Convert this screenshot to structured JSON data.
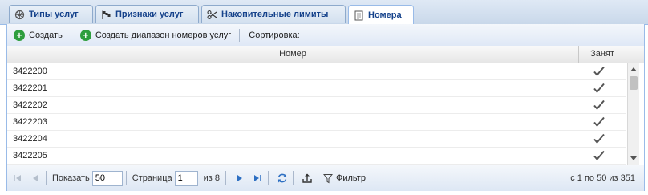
{
  "tabs": [
    {
      "label": "Типы услуг",
      "icon": "wheel-icon",
      "active": false
    },
    {
      "label": "Признаки услуг",
      "icon": "flag-icon",
      "active": false
    },
    {
      "label": "Накопительные лимиты",
      "icon": "scissors-icon",
      "active": false
    },
    {
      "label": "Номера",
      "icon": "document-icon",
      "active": true
    }
  ],
  "toolbar": {
    "create_label": "Создать",
    "create_range_label": "Создать диапазон номеров услуг",
    "sort_label": "Сортировка:"
  },
  "grid": {
    "columns": [
      "Номер",
      "Занят"
    ],
    "rows": [
      {
        "number": "3422200",
        "occupied": true
      },
      {
        "number": "3422201",
        "occupied": true
      },
      {
        "number": "3422202",
        "occupied": true
      },
      {
        "number": "3422203",
        "occupied": true
      },
      {
        "number": "3422204",
        "occupied": true
      },
      {
        "number": "3422205",
        "occupied": true
      }
    ]
  },
  "pager": {
    "show_label": "Показать",
    "page_size": "50",
    "page_label": "Страница",
    "page_value": "1",
    "of_pages": "из 8",
    "filter_label": "Фильтр",
    "info": "с 1 по 50 из 351"
  },
  "colors": {
    "accent": "#15428b",
    "check": "#555555",
    "add": "#2e9e3e"
  }
}
